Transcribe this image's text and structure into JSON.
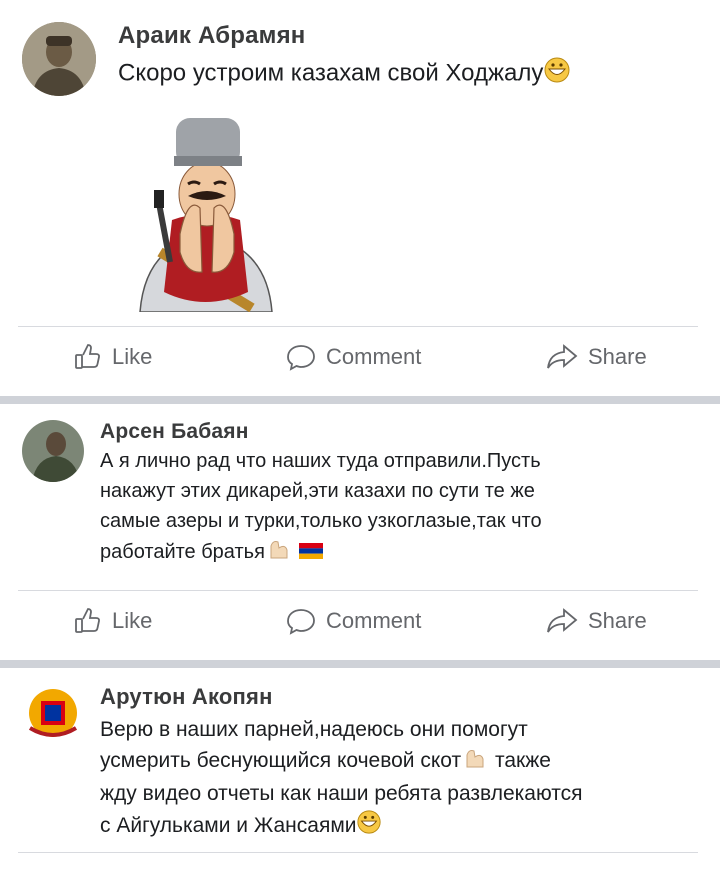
{
  "posts": [
    {
      "author": "Араик Абрамян",
      "text": "Скоро устроим казахам свой Ходжалу"
    },
    {
      "author": "Арсен Бабаян",
      "lines": [
        "А я лично рад что наших туда отправили.Пусть",
        "накажут этих дикарей,эти казахи по сути те же",
        "самые азеры и турки,только узкоглазые,так что",
        "работайте братья"
      ]
    },
    {
      "author": "Арутюн Акопян",
      "lines": [
        "Верю в наших парней,надеюсь они помогут",
        "усмерить беснующийся кочевой скот",
        "жду видео отчеты как наши ребята развлекаются",
        "с Айгульками и Жансаями"
      ],
      "line2_suffix": "также"
    }
  ],
  "actions": {
    "like": "Like",
    "comment": "Comment",
    "share": "Share"
  },
  "icons": [
    "like-icon",
    "comment-icon",
    "share-icon",
    "grinning-emoji",
    "flexed-arm-emoji",
    "armenian-flag-emoji"
  ],
  "colors": {
    "action_text": "#65676b",
    "name": "#3a3b3c",
    "divider": "#cfd2d8",
    "flag_red": "#d90012",
    "flag_blue": "#0033a0",
    "flag_orange": "#f2a800"
  }
}
